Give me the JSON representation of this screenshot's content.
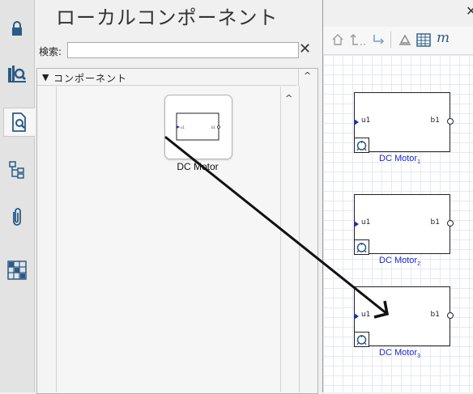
{
  "panel": {
    "title": "ローカルコンポーネント",
    "search": {
      "label": "検索:",
      "value": "",
      "placeholder": ""
    },
    "tree": {
      "node_label": "コンポーネント"
    },
    "components": [
      {
        "name": "DC Motor",
        "port_in": "u1",
        "port_out": "b1"
      }
    ]
  },
  "canvas": {
    "blocks": [
      {
        "name": "DC Motor",
        "index": "1",
        "port_in": "u1",
        "port_out": "b1"
      },
      {
        "name": "DC Motor",
        "index": "2",
        "port_in": "u1",
        "port_out": "b1"
      },
      {
        "name": "DC Motor",
        "index": "3",
        "port_in": "u1",
        "port_out": "b1"
      }
    ]
  },
  "colors": {
    "accent": "#1a28c8",
    "port": "#1d2fa8",
    "sidebar_icon": "#2b5b86"
  },
  "icons": [
    "lock-icon",
    "library-search-icon",
    "document-search-icon",
    "hierarchy-icon",
    "attachment-icon",
    "component-grid-icon",
    "home-icon",
    "navigate-up-icon",
    "navigate-down-icon",
    "chart-icon",
    "table-icon",
    "close-icon"
  ]
}
